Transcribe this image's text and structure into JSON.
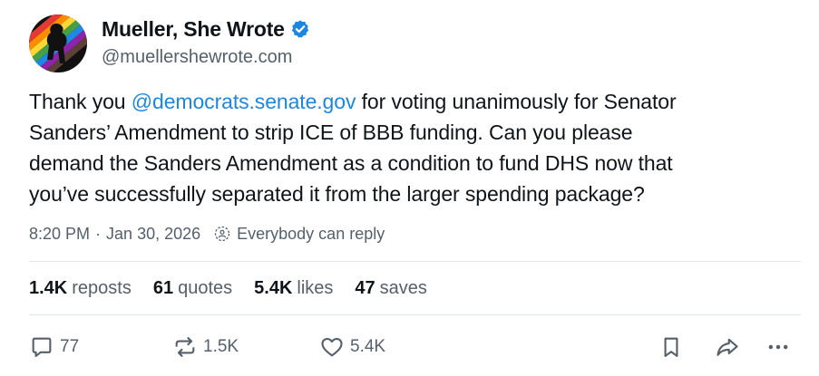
{
  "author": {
    "display_name": "Mueller, She Wrote",
    "handle": "@muellershewrote.com",
    "verified_icon": "verified-check-icon",
    "avatar_colors": [
      "#e53935",
      "#fb8c00",
      "#fdd835",
      "#43a047",
      "#1e88e5",
      "#8e24aa",
      "#5d4037",
      "#111111"
    ]
  },
  "post": {
    "line1_before": "Thank you ",
    "mention": "@democrats.senate.gov",
    "line1_after": " for voting unanimously for Senator",
    "line2": "Sanders’ Amendment to strip ICE of BBB funding. Can you please",
    "line3": "demand the Sanders Amendment as a condition to fund DHS now that",
    "line4": "you’ve successfully separated it from the larger spending package?"
  },
  "meta": {
    "time": "8:20 PM",
    "separator": "·",
    "date": "Jan 30, 2026",
    "reply_setting": "Everybody can reply"
  },
  "stats": {
    "reposts_count": "1.4K",
    "reposts_label": "reposts",
    "quotes_count": "61",
    "quotes_label": "quotes",
    "likes_count": "5.4K",
    "likes_label": "likes",
    "saves_count": "47",
    "saves_label": "saves"
  },
  "actions": {
    "reply_count": "77",
    "repost_count": "1.5K",
    "like_count": "5.4K"
  },
  "colors": {
    "accent": "#1d87e0",
    "text": "#0f1419",
    "muted": "#55606b",
    "divider": "#e3e6e9"
  }
}
